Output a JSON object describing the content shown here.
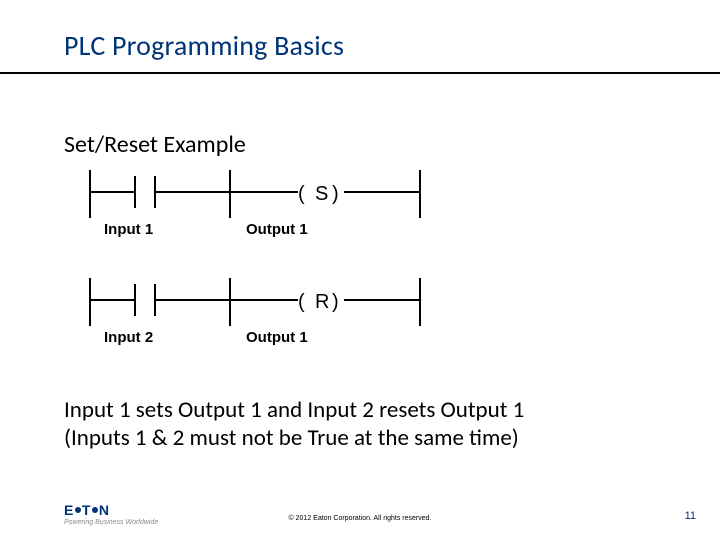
{
  "title": "PLC Programming Basics",
  "subtitle": "Set/Reset Example",
  "diagram": {
    "rung1": {
      "input_label": "Input 1",
      "output_label": "Output 1",
      "coil_letter": "S"
    },
    "rung2": {
      "input_label": "Input 2",
      "output_label": "Output 1",
      "coil_letter": "R"
    }
  },
  "body_line1": "Input 1 sets Output 1 and Input 2 resets Output 1",
  "body_line2": "(Inputs 1 & 2 must not be True at the same time)",
  "logo": {
    "text": "E T N",
    "tagline": "Powering Business Worldwide"
  },
  "copyright": "© 2012 Eaton Corporation. All rights reserved.",
  "page_number": "11"
}
